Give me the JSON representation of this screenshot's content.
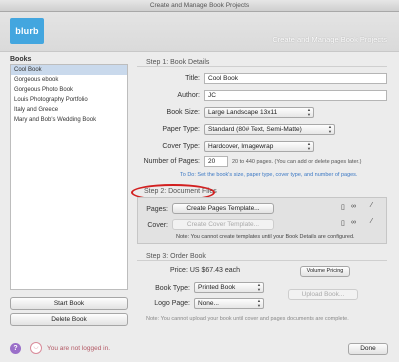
{
  "window": {
    "title": "Create and Manage Book Projects"
  },
  "header": {
    "logo_text": "blurb",
    "title": "Create and Manage Book Projects"
  },
  "sidebar": {
    "label": "Books",
    "books": [
      "Cool Book",
      "Gorgeous ebook",
      "Gorgeous Photo Book",
      "Louis Photography Portfolio",
      "Italy and Greece",
      "Mary and Bob's Wedding Book"
    ],
    "selected_index": 0,
    "start_button": "Start Book",
    "delete_button": "Delete Book"
  },
  "step1": {
    "title": "Step 1: Book Details",
    "title_label": "Title:",
    "title_value": "Cool Book",
    "author_label": "Author:",
    "author_value": "JC",
    "book_size_label": "Book Size:",
    "book_size_value": "Large Landscape 13x11",
    "paper_type_label": "Paper Type:",
    "paper_type_value": "Standard (80# Text, Semi-Matte)",
    "cover_type_label": "Cover Type:",
    "cover_type_value": "Hardcover, Imagewrap",
    "pages_label": "Number of Pages:",
    "pages_value": "20",
    "pages_hint": "20 to 440 pages. (You can add or delete pages later.)",
    "todo": "To Do: Set the book's size, paper type, cover type, and number of pages."
  },
  "step2": {
    "title": "Step 2: Document Files",
    "pages_label": "Pages:",
    "pages_button": "Create Pages Template...",
    "cover_label": "Cover:",
    "cover_button": "Create Cover Template...",
    "note": "Note: You cannot create templates until your Book Details are configured."
  },
  "step3": {
    "title": "Step 3: Order Book",
    "price_text": "Price: US $67.43 each",
    "volume_button": "Volume Pricing",
    "book_type_label": "Book Type:",
    "book_type_value": "Printed Book",
    "logo_page_label": "Logo Page:",
    "logo_page_value": "None...",
    "upload_button": "Upload Book...",
    "note": "Note: You cannot upload your book until cover and pages documents are complete."
  },
  "footer": {
    "help_glyph": "?",
    "login_status": "You are not logged in.",
    "done_button": "Done"
  },
  "colors": {
    "accent": "#43a6df",
    "highlight_oval": "#d21f1f",
    "todo_text": "#3b78c4"
  }
}
